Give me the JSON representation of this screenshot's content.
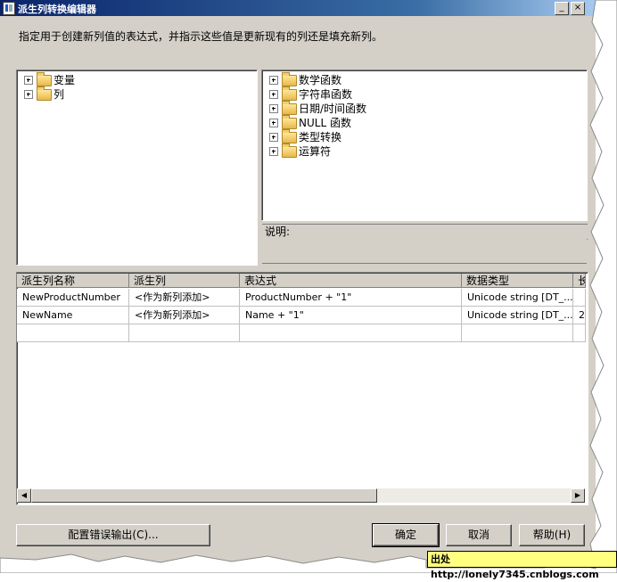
{
  "window": {
    "title": "派生列转换编辑器",
    "instruction": "指定用于创建新列值的表达式，并指示这些值是更新现有的列还是填充新列。",
    "minimize_glyph": "_",
    "close_glyph": "×"
  },
  "left_tree": {
    "items": [
      {
        "label": "变量",
        "icon": "folder-icon"
      },
      {
        "label": "列",
        "icon": "folder-icon"
      }
    ]
  },
  "right_tree": {
    "items": [
      {
        "label": "数学函数",
        "icon": "folder-icon"
      },
      {
        "label": "字符串函数",
        "icon": "folder-icon"
      },
      {
        "label": "日期/时间函数",
        "icon": "folder-icon"
      },
      {
        "label": "NULL 函数",
        "icon": "folder-icon"
      },
      {
        "label": "类型转换",
        "icon": "folder-icon"
      },
      {
        "label": "运算符",
        "icon": "folder-icon"
      }
    ]
  },
  "description": {
    "label": "说明:"
  },
  "grid": {
    "columns": [
      "派生列名称",
      "派生列",
      "表达式",
      "数据类型",
      "长"
    ],
    "rows": [
      [
        "NewProductNumber",
        "<作为新列添加>",
        "ProductNumber + \"1\"",
        "Unicode string [DT_...",
        ""
      ],
      [
        "NewName",
        "<作为新列添加>",
        "Name + \"1\"",
        "Unicode string [DT_...",
        "2"
      ]
    ]
  },
  "scrollbar": {
    "left_arrow": "◀",
    "right_arrow": "▶"
  },
  "buttons": {
    "config_error": "配置错误输出(C)...",
    "ok": "确定",
    "cancel": "取消",
    "help": "帮助(H)"
  },
  "watermark": "出处http://lonely7345.cnblogs.com",
  "colors": {
    "window_bg": "#d4d0c8",
    "title_bar": "#0a246a",
    "watermark_bg": "#ffff80"
  }
}
